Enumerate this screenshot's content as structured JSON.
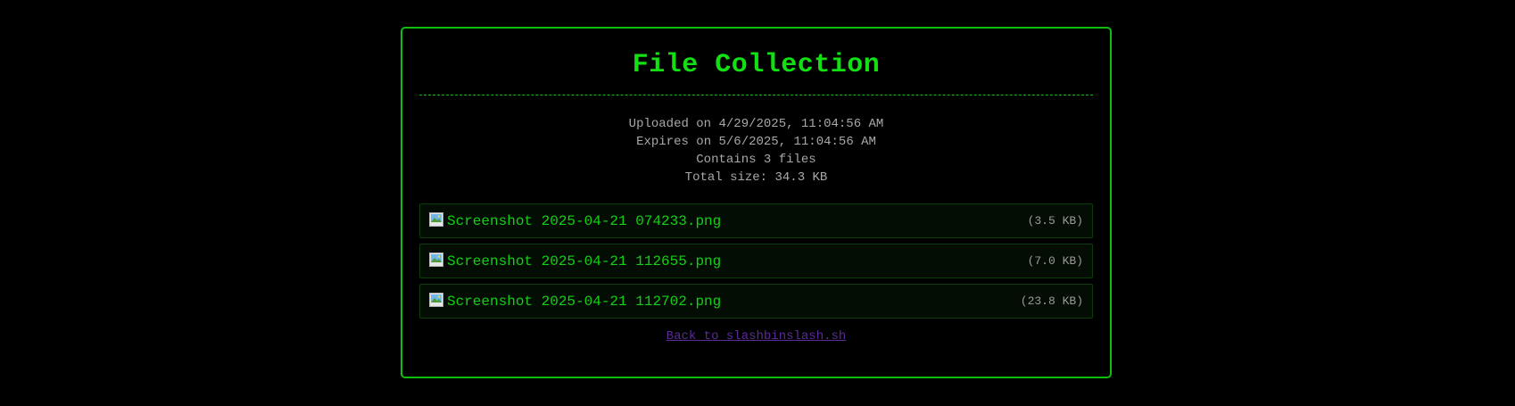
{
  "page": {
    "title": "File Collection"
  },
  "meta": {
    "uploaded": "Uploaded on 4/29/2025, 11:04:56 AM",
    "expires": "Expires on 5/6/2025, 11:04:56 AM",
    "count": "Contains 3 files",
    "total_size": "Total size: 34.3 KB"
  },
  "files": [
    {
      "icon": "image-file-icon",
      "name": "Screenshot 2025-04-21 074233.png",
      "size": "(3.5 KB)"
    },
    {
      "icon": "image-file-icon",
      "name": "Screenshot 2025-04-21 112655.png",
      "size": "(7.0 KB)"
    },
    {
      "icon": "image-file-icon",
      "name": "Screenshot 2025-04-21 112702.png",
      "size": "(23.8 KB)"
    }
  ],
  "footer": {
    "back_link": "Back to slashbinslash.sh"
  },
  "colors": {
    "background": "#000000",
    "accent": "#13e013",
    "border": "#0fbf0f",
    "meta_text": "#a8a8a8",
    "link_visited": "#5b2a9a"
  }
}
